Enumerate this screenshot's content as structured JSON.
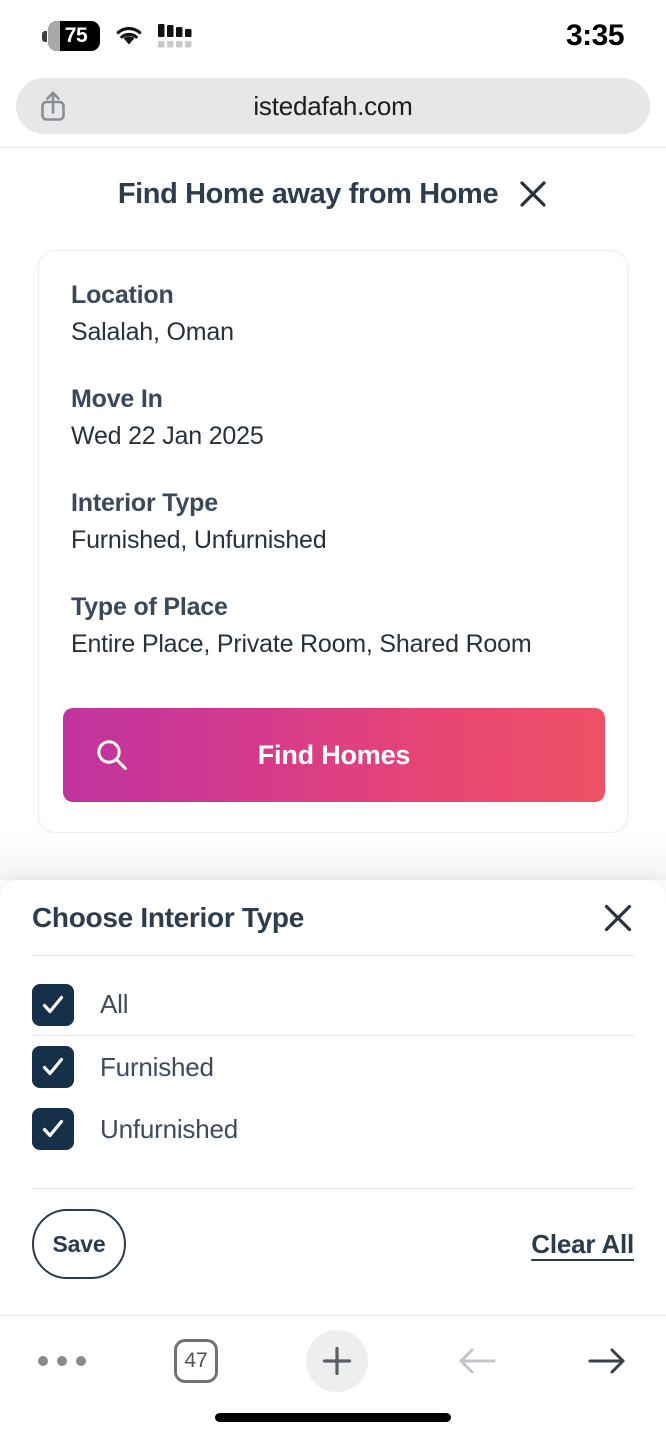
{
  "status_bar": {
    "battery_level": "75",
    "battery_icon": "battery-icon",
    "wifi_icon": "wifi-icon",
    "signal_icon": "signal-bars-icon",
    "time": "3:35"
  },
  "browser": {
    "share_icon": "share-icon",
    "url": "istedafah.com",
    "toolbar": {
      "more_icon": "more-dots-icon",
      "tab_count": "47",
      "new_tab_icon": "plus-icon",
      "back_icon": "arrow-left-icon",
      "forward_icon": "arrow-right-icon"
    }
  },
  "page": {
    "title": "Find Home away from Home",
    "close_icon": "close-icon"
  },
  "search_card": {
    "fields": [
      {
        "label": "Location",
        "value": "Salalah, Oman"
      },
      {
        "label": "Move In",
        "value": "Wed 22 Jan 2025"
      },
      {
        "label": "Interior Type",
        "value": "Furnished, Unfurnished"
      },
      {
        "label": "Type of Place",
        "value": "Entire Place, Private Room, Shared Room"
      }
    ],
    "find_button": {
      "label": "Find Homes",
      "icon": "search-icon",
      "gradient_start": "#bf349f",
      "gradient_end": "#ef5165"
    }
  },
  "sheet": {
    "title": "Choose Interior Type",
    "close_icon": "close-icon",
    "options": [
      {
        "label": "All",
        "checked": true
      },
      {
        "label": "Furnished",
        "checked": true
      },
      {
        "label": "Unfurnished",
        "checked": true
      }
    ],
    "checkbox_color": "#16304a",
    "save_label": "Save",
    "clear_all_label": "Clear All"
  }
}
